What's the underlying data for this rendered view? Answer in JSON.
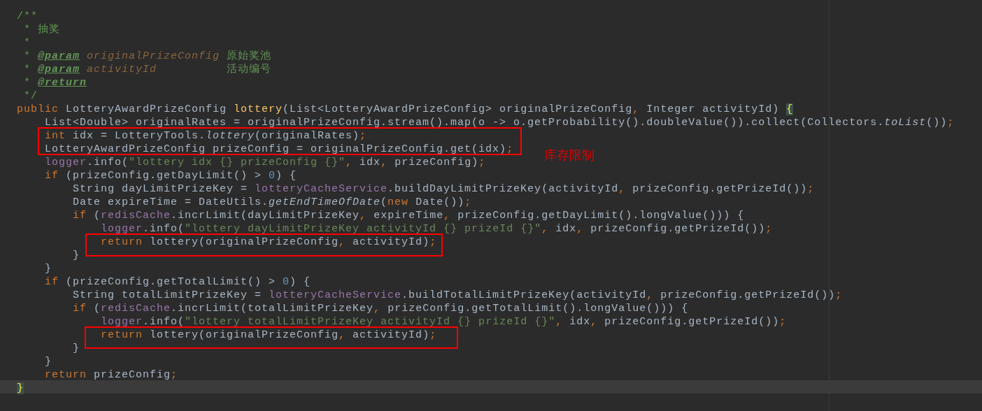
{
  "editor": {
    "lines": [
      {
        "current": false,
        "tokens": [
          {
            "kind": "doc",
            "text": "/**"
          }
        ]
      },
      {
        "current": false,
        "tokens": [
          {
            "kind": "doc",
            "text": " * 抽奖"
          }
        ]
      },
      {
        "current": false,
        "tokens": [
          {
            "kind": "doc",
            "text": " *"
          }
        ]
      },
      {
        "current": false,
        "tokens": [
          {
            "kind": "doc",
            "text": " * "
          },
          {
            "kind": "doctag",
            "text": "@param"
          },
          {
            "kind": "docparam",
            "text": " originalPrizeConfig"
          },
          {
            "kind": "doc",
            "text": " 原始奖池"
          }
        ]
      },
      {
        "current": false,
        "tokens": [
          {
            "kind": "doc",
            "text": " * "
          },
          {
            "kind": "doctag",
            "text": "@param"
          },
          {
            "kind": "docparam",
            "text": " activityId"
          },
          {
            "kind": "doc",
            "text": "          活动编号"
          }
        ]
      },
      {
        "current": false,
        "tokens": [
          {
            "kind": "doc",
            "text": " * "
          },
          {
            "kind": "doctag",
            "text": "@return"
          }
        ]
      },
      {
        "current": false,
        "tokens": [
          {
            "kind": "doc",
            "text": " */"
          }
        ]
      },
      {
        "current": false,
        "tokens": [
          {
            "kind": "keyword",
            "text": "public"
          },
          {
            "kind": "plain",
            "text": " LotteryAwardPrizeConfig "
          },
          {
            "kind": "method",
            "text": "lottery"
          },
          {
            "kind": "plain",
            "text": "(List<LotteryAwardPrizeConfig> originalPrizeConfig"
          },
          {
            "kind": "punct",
            "text": ","
          },
          {
            "kind": "plain",
            "text": " Integer activityId) "
          },
          {
            "kind": "brace",
            "text": "{"
          }
        ]
      },
      {
        "current": false,
        "tokens": [
          {
            "kind": "plain",
            "text": "    List<Double> originalRates = originalPrizeConfig.stream().map(o -> o.getProbability().doubleValue()).collect(Collectors."
          },
          {
            "kind": "static",
            "text": "toList"
          },
          {
            "kind": "plain",
            "text": "())"
          },
          {
            "kind": "punct",
            "text": ";"
          }
        ]
      },
      {
        "current": false,
        "tokens": [
          {
            "kind": "keyword",
            "text": "    int"
          },
          {
            "kind": "plain",
            "text": " idx = LotteryTools."
          },
          {
            "kind": "static",
            "text": "lottery"
          },
          {
            "kind": "plain",
            "text": "(originalRates)"
          },
          {
            "kind": "punct",
            "text": ";"
          }
        ]
      },
      {
        "current": false,
        "tokens": [
          {
            "kind": "plain",
            "text": "    LotteryAwardPrizeConfig prizeConfig = originalPrizeConfig.get(idx)"
          },
          {
            "kind": "punct",
            "text": ";"
          }
        ]
      },
      {
        "current": false,
        "tokens": [
          {
            "kind": "field",
            "text": "    logger"
          },
          {
            "kind": "plain",
            "text": ".info("
          },
          {
            "kind": "string",
            "text": "\"lottery idx {} prizeConfig {}\""
          },
          {
            "kind": "punct",
            "text": ","
          },
          {
            "kind": "plain",
            "text": " idx"
          },
          {
            "kind": "punct",
            "text": ","
          },
          {
            "kind": "plain",
            "text": " prizeConfig)"
          },
          {
            "kind": "punct",
            "text": ";"
          }
        ]
      },
      {
        "current": false,
        "tokens": [
          {
            "kind": "keyword",
            "text": "    if"
          },
          {
            "kind": "plain",
            "text": " (prizeConfig.getDayLimit() > "
          },
          {
            "kind": "number",
            "text": "0"
          },
          {
            "kind": "plain",
            "text": ") {"
          }
        ]
      },
      {
        "current": false,
        "tokens": [
          {
            "kind": "plain",
            "text": "        String dayLimitPrizeKey = "
          },
          {
            "kind": "field",
            "text": "lotteryCacheService"
          },
          {
            "kind": "plain",
            "text": ".buildDayLimitPrizeKey(activityId"
          },
          {
            "kind": "punct",
            "text": ","
          },
          {
            "kind": "plain",
            "text": " prizeConfig.getPrizeId())"
          },
          {
            "kind": "punct",
            "text": ";"
          }
        ]
      },
      {
        "current": false,
        "tokens": [
          {
            "kind": "plain",
            "text": "        Date expireTime = DateUtils."
          },
          {
            "kind": "static",
            "text": "getEndTimeOfDate"
          },
          {
            "kind": "plain",
            "text": "("
          },
          {
            "kind": "keyword",
            "text": "new"
          },
          {
            "kind": "plain",
            "text": " Date())"
          },
          {
            "kind": "punct",
            "text": ";"
          }
        ]
      },
      {
        "current": false,
        "tokens": [
          {
            "kind": "keyword",
            "text": "        if"
          },
          {
            "kind": "plain",
            "text": " ("
          },
          {
            "kind": "field",
            "text": "redisCache"
          },
          {
            "kind": "plain",
            "text": ".incrLimit(dayLimitPrizeKey"
          },
          {
            "kind": "punct",
            "text": ","
          },
          {
            "kind": "plain",
            "text": " expireTime"
          },
          {
            "kind": "punct",
            "text": ","
          },
          {
            "kind": "plain",
            "text": " prizeConfig.getDayLimit().longValue())) {"
          }
        ]
      },
      {
        "current": false,
        "tokens": [
          {
            "kind": "field",
            "text": "            logger"
          },
          {
            "kind": "plain",
            "text": ".info("
          },
          {
            "kind": "string",
            "text": "\"lottery dayLimitPrizeKey activityId {} prizeId {}\""
          },
          {
            "kind": "punct",
            "text": ","
          },
          {
            "kind": "plain",
            "text": " idx"
          },
          {
            "kind": "punct",
            "text": ","
          },
          {
            "kind": "plain",
            "text": " prizeConfig.getPrizeId())"
          },
          {
            "kind": "punct",
            "text": ";"
          }
        ]
      },
      {
        "current": false,
        "tokens": [
          {
            "kind": "keyword",
            "text": "            return"
          },
          {
            "kind": "plain",
            "text": " lottery(originalPrizeConfig"
          },
          {
            "kind": "punct",
            "text": ","
          },
          {
            "kind": "plain",
            "text": " activityId)"
          },
          {
            "kind": "punct",
            "text": ";"
          }
        ]
      },
      {
        "current": false,
        "tokens": [
          {
            "kind": "plain",
            "text": "        }"
          }
        ]
      },
      {
        "current": false,
        "tokens": [
          {
            "kind": "plain",
            "text": "    }"
          }
        ]
      },
      {
        "current": false,
        "tokens": [
          {
            "kind": "keyword",
            "text": "    if"
          },
          {
            "kind": "plain",
            "text": " (prizeConfig.getTotalLimit() > "
          },
          {
            "kind": "number",
            "text": "0"
          },
          {
            "kind": "plain",
            "text": ") {"
          }
        ]
      },
      {
        "current": false,
        "tokens": [
          {
            "kind": "plain",
            "text": "        String totalLimitPrizeKey = "
          },
          {
            "kind": "field",
            "text": "lotteryCacheService"
          },
          {
            "kind": "plain",
            "text": ".buildTotalLimitPrizeKey(activityId"
          },
          {
            "kind": "punct",
            "text": ","
          },
          {
            "kind": "plain",
            "text": " prizeConfig.getPrizeId())"
          },
          {
            "kind": "punct",
            "text": ";"
          }
        ]
      },
      {
        "current": false,
        "tokens": [
          {
            "kind": "keyword",
            "text": "        if"
          },
          {
            "kind": "plain",
            "text": " ("
          },
          {
            "kind": "field",
            "text": "redisCache"
          },
          {
            "kind": "plain",
            "text": ".incrLimit(totalLimitPrizeKey"
          },
          {
            "kind": "punct",
            "text": ","
          },
          {
            "kind": "plain",
            "text": " prizeConfig.getTotalLimit().longValue())) {"
          }
        ]
      },
      {
        "current": false,
        "tokens": [
          {
            "kind": "field",
            "text": "            logger"
          },
          {
            "kind": "plain",
            "text": ".info("
          },
          {
            "kind": "string",
            "text": "\"lottery totalLimitPrizeKey activityId {} prizeId {}\""
          },
          {
            "kind": "punct",
            "text": ","
          },
          {
            "kind": "plain",
            "text": " idx"
          },
          {
            "kind": "punct",
            "text": ","
          },
          {
            "kind": "plain",
            "text": " prizeConfig.getPrizeId())"
          },
          {
            "kind": "punct",
            "text": ";"
          }
        ]
      },
      {
        "current": false,
        "tokens": [
          {
            "kind": "keyword",
            "text": "            return"
          },
          {
            "kind": "plain",
            "text": " lottery(originalPrizeConfig"
          },
          {
            "kind": "punct",
            "text": ","
          },
          {
            "kind": "plain",
            "text": " activityId)"
          },
          {
            "kind": "punct",
            "text": ";"
          }
        ]
      },
      {
        "current": false,
        "tokens": [
          {
            "kind": "plain",
            "text": "        }"
          }
        ]
      },
      {
        "current": false,
        "tokens": [
          {
            "kind": "plain",
            "text": "    }"
          }
        ]
      },
      {
        "current": false,
        "tokens": [
          {
            "kind": "keyword",
            "text": "    return"
          },
          {
            "kind": "plain",
            "text": " prizeConfig"
          },
          {
            "kind": "punct",
            "text": ";"
          }
        ]
      },
      {
        "current": true,
        "tokens": [
          {
            "kind": "brace",
            "text": "}"
          }
        ]
      }
    ]
  },
  "annotations": [
    {
      "kind": "box"
    },
    {
      "kind": "box"
    },
    {
      "kind": "box"
    },
    {
      "kind": "note",
      "text": "库存限制"
    }
  ]
}
